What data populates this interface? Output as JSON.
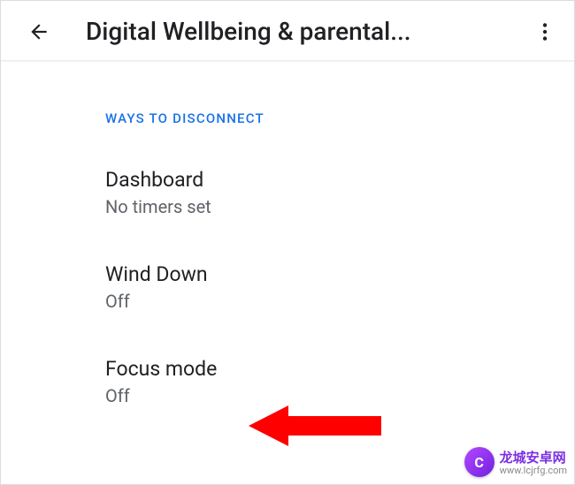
{
  "header": {
    "title": "Digital Wellbeing & parental..."
  },
  "section": {
    "label": "WAYS TO DISCONNECT",
    "items": [
      {
        "title": "Dashboard",
        "subtitle": "No timers set"
      },
      {
        "title": "Wind Down",
        "subtitle": "Off"
      },
      {
        "title": "Focus mode",
        "subtitle": "Off"
      }
    ]
  },
  "watermark": {
    "badge": "C",
    "text_cn": "龙城安卓网",
    "url": "www.lcjrfg.com"
  }
}
